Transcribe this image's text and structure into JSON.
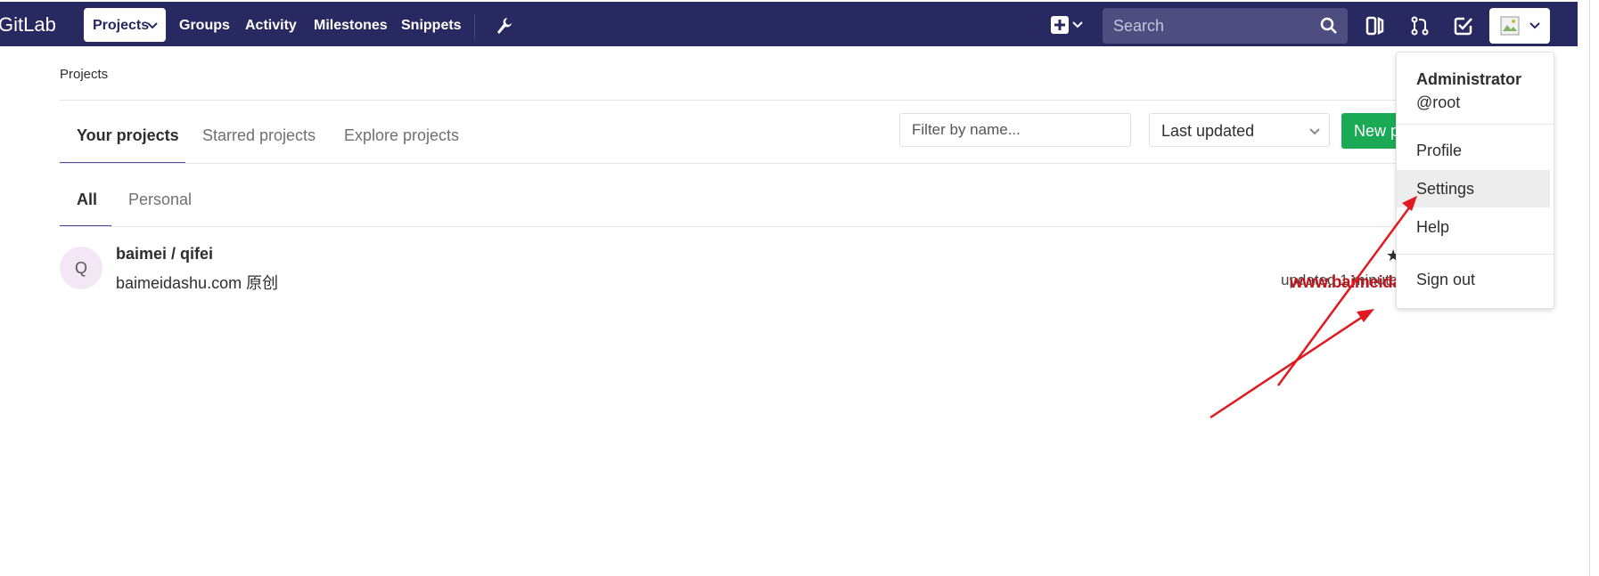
{
  "navbar": {
    "logo": "GitLab",
    "projects_label": "Projects",
    "groups_label": "Groups",
    "activity_label": "Activity",
    "milestones_label": "Milestones",
    "snippets_label": "Snippets",
    "search_placeholder": "Search"
  },
  "breadcrumb": "Projects",
  "tabs": {
    "your_projects": "Your projects",
    "starred_projects": "Starred projects",
    "explore_projects": "Explore projects"
  },
  "filter_placeholder": "Filter by name...",
  "sort_selected": "Last updated",
  "new_project_label": "New project",
  "subtabs": {
    "all": "All",
    "personal": "Personal"
  },
  "project": {
    "avatar_letter": "Q",
    "name": "baimei / qifei",
    "description": "baimeidashu.com 原创",
    "updated": "updated 1 minute ago"
  },
  "user_dropdown": {
    "name": "Administrator",
    "username": "@root",
    "profile": "Profile",
    "settings": "Settings",
    "help": "Help",
    "sign_out": "Sign out"
  },
  "watermark": "www.baimeidashu.com-白眉大叔",
  "colors": {
    "navbar": "#292961",
    "accent": "#4b4ba3",
    "new_button": "#1aaa55",
    "annotation": "#e0191f"
  }
}
